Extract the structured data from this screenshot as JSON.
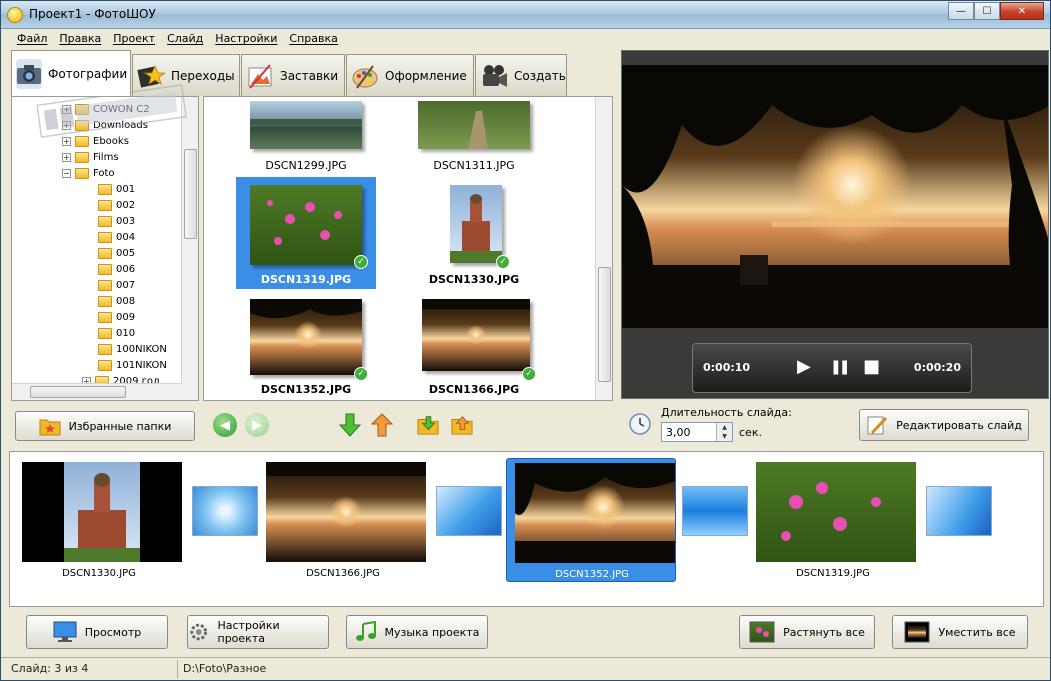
{
  "window": {
    "title": "Проект1 - ФотоШОУ",
    "buttons": {
      "minimize": "—",
      "maximize": "☐",
      "close": "✕"
    }
  },
  "menu": [
    "Файл",
    "Правка",
    "Проект",
    "Слайд",
    "Настройки",
    "Справка"
  ],
  "tabs": [
    {
      "label": "Фотографии",
      "icon": "camera-icon",
      "active": true
    },
    {
      "label": "Переходы",
      "icon": "transitions-icon",
      "active": false
    },
    {
      "label": "Заставки",
      "icon": "titles-icon",
      "active": false
    },
    {
      "label": "Оформление",
      "icon": "palette-icon",
      "active": false
    },
    {
      "label": "Создать",
      "icon": "video-camera-icon",
      "active": false
    }
  ],
  "tree": {
    "items": [
      {
        "label": "COWON C2",
        "expander": "+"
      },
      {
        "label": "Downloads",
        "expander": "+"
      },
      {
        "label": "Ebooks",
        "expander": "+"
      },
      {
        "label": "Films",
        "expander": "+"
      },
      {
        "label": "Foto",
        "expander": "−"
      },
      {
        "label": "001"
      },
      {
        "label": "002"
      },
      {
        "label": "003"
      },
      {
        "label": "004"
      },
      {
        "label": "005"
      },
      {
        "label": "006"
      },
      {
        "label": "007"
      },
      {
        "label": "008"
      },
      {
        "label": "009"
      },
      {
        "label": "010"
      },
      {
        "label": "100NIKON"
      },
      {
        "label": "101NIKON"
      },
      {
        "label": "2009 год",
        "expander": "+"
      }
    ]
  },
  "favorites_button": "Избранные папки",
  "files": [
    {
      "name": "DSCN1299.JPG",
      "bold": false,
      "checked": false,
      "selected": false
    },
    {
      "name": "DSCN1311.JPG",
      "bold": false,
      "checked": false,
      "selected": false
    },
    {
      "name": "DSCN1319.JPG",
      "bold": true,
      "checked": true,
      "selected": true
    },
    {
      "name": "DSCN1330.JPG",
      "bold": true,
      "checked": true,
      "selected": false
    },
    {
      "name": "DSCN1352.JPG",
      "bold": true,
      "checked": true,
      "selected": false
    },
    {
      "name": "DSCN1366.JPG",
      "bold": true,
      "checked": true,
      "selected": false
    }
  ],
  "player": {
    "time_start": "0:00:10",
    "time_end": "0:00:20",
    "play": "▶",
    "pause": "❚❚",
    "stop": "■"
  },
  "duration": {
    "label": "Длительность слайда:",
    "value": "3,00",
    "unit": "сек.",
    "edit_button": "Редактировать слайд"
  },
  "timeline": [
    {
      "name": "DSCN1330.JPG",
      "selected": false
    },
    {
      "name": "DSCN1366.JPG",
      "selected": false
    },
    {
      "name": "DSCN1352.JPG",
      "selected": true
    },
    {
      "name": "DSCN1319.JPG",
      "selected": false
    }
  ],
  "bottom_buttons": {
    "preview": "Просмотр",
    "project_settings": "Настройки проекта",
    "project_music": "Музыка проекта",
    "stretch_all": "Растянуть все",
    "fit_all": "Уместить все"
  },
  "status": {
    "slide": "Слайд: 3 из 4",
    "path": "D:\\Foto\\Разное"
  },
  "colors": {
    "selection": "#3a8ee6",
    "titlebar": "#a9c6de",
    "panel_bg": "#ece9d8"
  }
}
